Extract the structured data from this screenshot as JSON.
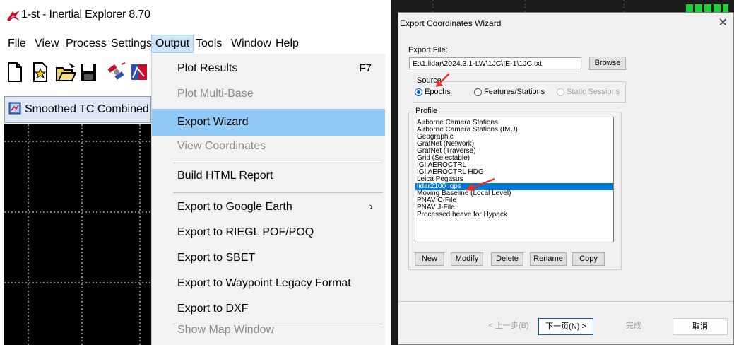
{
  "window": {
    "title": "1-st - Inertial Explorer 8.70"
  },
  "menubar": {
    "items": [
      "File",
      "View",
      "Process",
      "Settings",
      "Output",
      "Tools",
      "Window",
      "Help"
    ],
    "active": "Output"
  },
  "toolbar": {
    "icons": [
      "new-document-icon",
      "open-star-icon",
      "open-folder-icon",
      "save-icon",
      "satellite-icon",
      "process-icon"
    ]
  },
  "child_window": {
    "title": "Smoothed TC Combined - M"
  },
  "sidebar": {
    "items": [
      {
        "label": "Plot Results",
        "shortcut": "F7",
        "enabled": true
      },
      {
        "label": "Plot Multi-Base",
        "enabled": false
      },
      {
        "label": "Export Wizard",
        "enabled": true,
        "highlighted": true
      },
      {
        "label": "View Coordinates",
        "enabled": false
      },
      {
        "label": "Build HTML Report",
        "enabled": true
      },
      {
        "label": "Export to Google Earth",
        "submenu": true,
        "enabled": true
      },
      {
        "label": "Export to RIEGL POF/POQ",
        "enabled": true
      },
      {
        "label": "Export to SBET",
        "enabled": true
      },
      {
        "label": "Export to Waypoint Legacy Format",
        "enabled": true
      },
      {
        "label": "Export to DXF",
        "enabled": true
      },
      {
        "label": "Show Map Window",
        "enabled": false
      }
    ]
  },
  "dialog": {
    "title": "Export Coordinates Wizard",
    "export_file_label": "Export File:",
    "export_file_value": "E:\\1.lidar\\2024.3.1-LW\\1JC\\IE-1\\1JC.txt",
    "browse_label": "Browse",
    "source_label": "Source",
    "source_options": [
      {
        "label": "Epochs",
        "selected": true,
        "enabled": true
      },
      {
        "label": "Features/Stations",
        "selected": false,
        "enabled": true
      },
      {
        "label": "Static Sessions",
        "selected": false,
        "enabled": false
      }
    ],
    "profile_label": "Profile",
    "profiles": [
      "Airborne Camera Stations",
      "Airborne Camera Stations (IMU)",
      "Geographic",
      "GrafNet (Network)",
      "GrafNet (Traverse)",
      "Grid (Selectable)",
      "IGI AEROCTRL",
      "IGI AEROCTRL HDG",
      "Leica Pegasus",
      "lidar2100_gps",
      "Moving Baseline (Local Level)",
      "PNAV C-File",
      "PNAV J-File",
      "Processed heave for Hypack"
    ],
    "selected_profile": "lidar2100_gps",
    "profile_buttons": [
      "New",
      "Modify",
      "Delete",
      "Rename",
      "Copy"
    ],
    "nav_buttons": {
      "back": "< 上一步(B)",
      "next": "下一页(N) >",
      "finish": "完成",
      "cancel": "取消"
    }
  },
  "colors": {
    "menu_highlight": "#91c9f7",
    "menu_active": "#cce4f7",
    "list_selection": "#0078d7",
    "annotation_arrow": "#e8332a",
    "plot_background": "#000000",
    "plot_grid": "#ffffff"
  }
}
